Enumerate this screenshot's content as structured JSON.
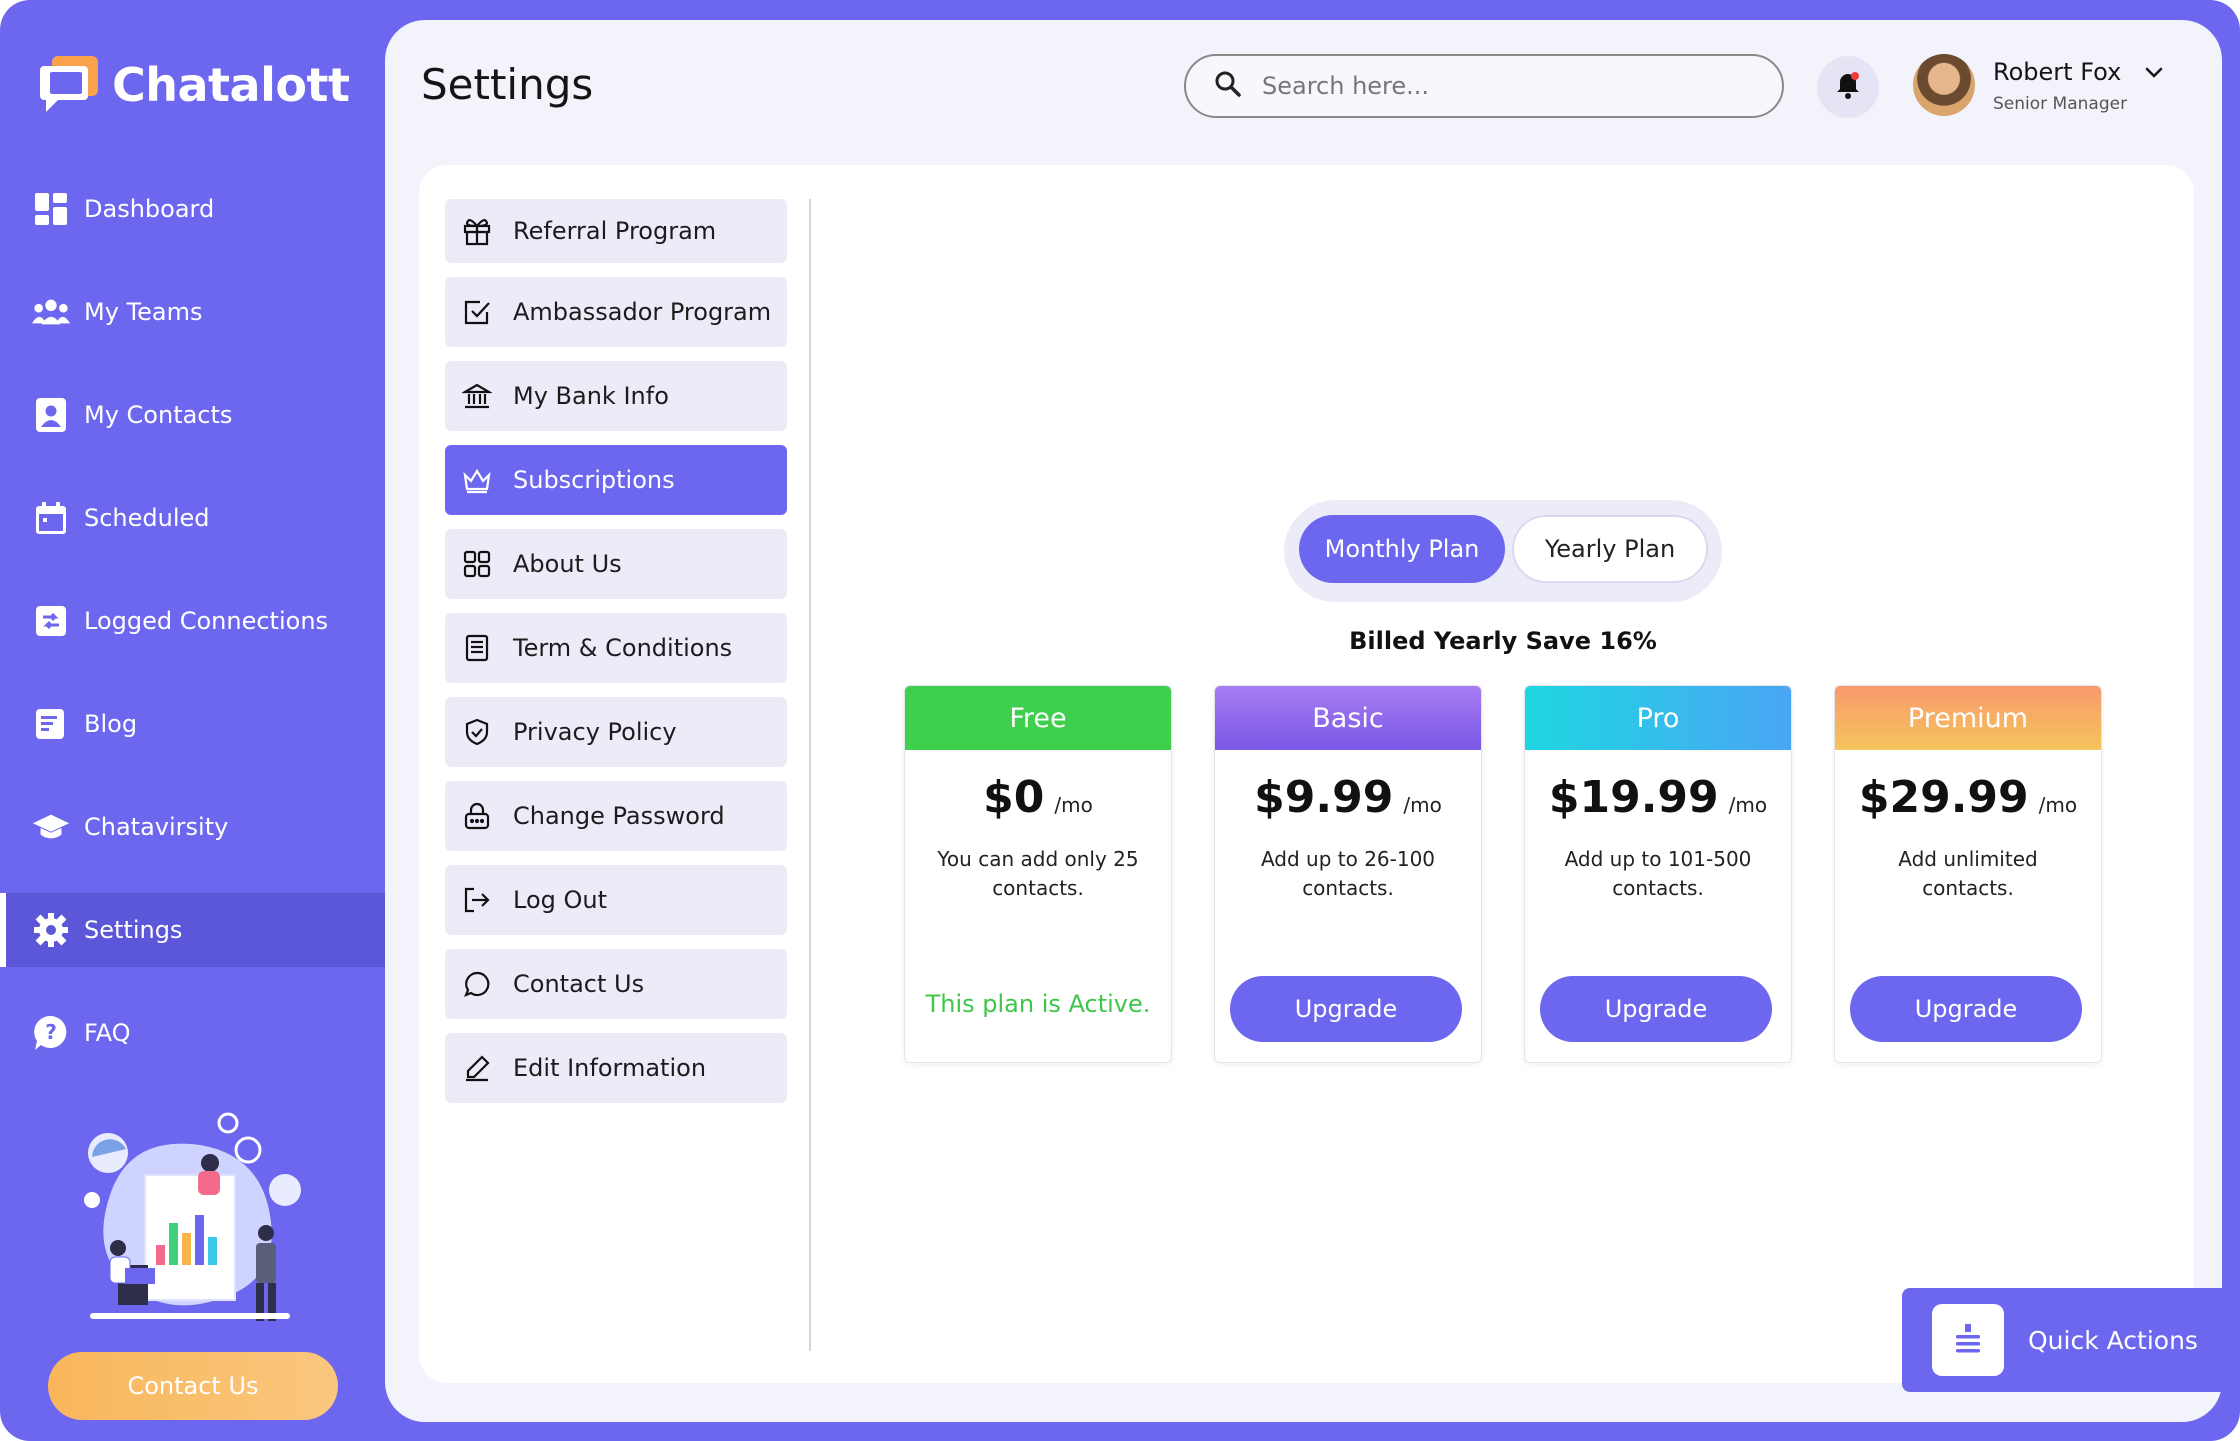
{
  "brand": {
    "name": "Chatalott"
  },
  "sidebar": {
    "items": [
      {
        "label": "Dashboard",
        "icon": "dashboard-icon"
      },
      {
        "label": "My Teams",
        "icon": "teams-icon"
      },
      {
        "label": "My Contacts",
        "icon": "contacts-icon"
      },
      {
        "label": "Scheduled",
        "icon": "calendar-icon"
      },
      {
        "label": "Logged Connections",
        "icon": "connections-icon"
      },
      {
        "label": "Blog",
        "icon": "blog-icon"
      },
      {
        "label": "Chatavirsity",
        "icon": "graduation-cap-icon"
      },
      {
        "label": "Settings",
        "icon": "gear-icon",
        "active": true
      },
      {
        "label": "FAQ",
        "icon": "question-icon"
      }
    ],
    "contact_button": "Contact Us"
  },
  "header": {
    "title": "Settings",
    "search_placeholder": "Search here...",
    "user": {
      "name": "Robert Fox",
      "role": "Senior Manager"
    }
  },
  "settings_menu": {
    "items": [
      {
        "label": "Referral Program",
        "icon": "gift-icon"
      },
      {
        "label": "Ambassador Program",
        "icon": "checkbox-icon"
      },
      {
        "label": "My Bank Info",
        "icon": "bank-icon"
      },
      {
        "label": "Subscriptions",
        "icon": "crown-icon",
        "active": true
      },
      {
        "label": "About Us",
        "icon": "grid-icon"
      },
      {
        "label": "Term & Conditions",
        "icon": "document-icon"
      },
      {
        "label": "Privacy Policy",
        "icon": "shield-icon"
      },
      {
        "label": "Change Password",
        "icon": "lock-icon"
      },
      {
        "label": "Log Out",
        "icon": "logout-icon"
      },
      {
        "label": "Contact Us",
        "icon": "chat-icon"
      },
      {
        "label": "Edit Information",
        "icon": "pencil-icon"
      }
    ]
  },
  "subscriptions": {
    "toggle": {
      "monthly": "Monthly Plan",
      "yearly": "Yearly Plan",
      "selected": "monthly"
    },
    "billing_note": "Billed Yearly Save 16%",
    "plans": [
      {
        "name": "Free",
        "price": "$0",
        "per": "/mo",
        "description": "You can add only 25 contacts.",
        "status": "This plan is Active.",
        "colors": [
          "#3ecf4c",
          "#3ecf4c"
        ]
      },
      {
        "name": "Basic",
        "price": "$9.99",
        "per": "/mo",
        "description": "Add up to 26-100 contacts.",
        "button": "Upgrade",
        "colors": [
          "#9b6cf0",
          "#7f5ae8"
        ]
      },
      {
        "name": "Pro",
        "price": "$19.99",
        "per": "/mo",
        "description": "Add up to 101-500 contacts.",
        "button": "Upgrade",
        "colors": [
          "#1ed6e0",
          "#4aa6f5"
        ]
      },
      {
        "name": "Premium",
        "price": "$29.99",
        "per": "/mo",
        "description": "Add unlimited contacts.",
        "button": "Upgrade",
        "colors": [
          "#f7a26a",
          "#f6c15f"
        ]
      }
    ]
  },
  "quick_actions": {
    "label": "Quick Actions"
  },
  "colors": {
    "accent": "#6d67ef",
    "active_green": "#3ec64b",
    "panel": "#f3f3fb"
  }
}
